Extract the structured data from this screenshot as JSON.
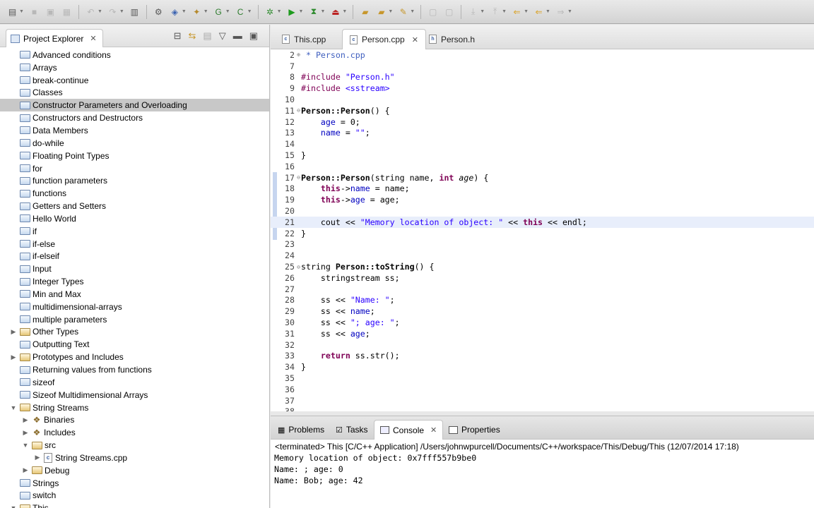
{
  "toolbar": {
    "icons": [
      "new-icon",
      "save-icon",
      "save-all-icon",
      "print-icon",
      "undo-icon",
      "build-icon",
      "gear-icon",
      "new-class-icon",
      "new-project-icon",
      "refresh-icon",
      "c-file-icon",
      "debug-icon",
      "run-icon",
      "external-tools-icon",
      "search-icon",
      "open-folder-icon",
      "edit-icon",
      "back-icon",
      "forward-icon"
    ]
  },
  "explorer": {
    "title": "Project Explorer",
    "items": [
      {
        "label": "Advanced conditions",
        "type": "folder",
        "indent": 0
      },
      {
        "label": "Arrays",
        "type": "folder",
        "indent": 0
      },
      {
        "label": "break-continue",
        "type": "folder",
        "indent": 0
      },
      {
        "label": "Classes",
        "type": "folder",
        "indent": 0
      },
      {
        "label": "Constructor Parameters and Overloading",
        "type": "folder",
        "indent": 0,
        "selected": true
      },
      {
        "label": "Constructors and Destructors",
        "type": "folder",
        "indent": 0
      },
      {
        "label": "Data Members",
        "type": "folder",
        "indent": 0
      },
      {
        "label": "do-while",
        "type": "folder",
        "indent": 0
      },
      {
        "label": "Floating Point Types",
        "type": "folder",
        "indent": 0
      },
      {
        "label": "for",
        "type": "folder",
        "indent": 0
      },
      {
        "label": "function parameters",
        "type": "folder",
        "indent": 0
      },
      {
        "label": "functions",
        "type": "folder",
        "indent": 0
      },
      {
        "label": "Getters and Setters",
        "type": "folder",
        "indent": 0
      },
      {
        "label": "Hello World",
        "type": "folder",
        "indent": 0
      },
      {
        "label": "if",
        "type": "folder",
        "indent": 0
      },
      {
        "label": "if-else",
        "type": "folder",
        "indent": 0
      },
      {
        "label": "if-elseif",
        "type": "folder",
        "indent": 0
      },
      {
        "label": "Input",
        "type": "folder",
        "indent": 0
      },
      {
        "label": "Integer Types",
        "type": "folder",
        "indent": 0
      },
      {
        "label": "Min and Max",
        "type": "folder",
        "indent": 0
      },
      {
        "label": "multidimensional-arrays",
        "type": "folder",
        "indent": 0
      },
      {
        "label": "multiple parameters",
        "type": "folder",
        "indent": 0
      },
      {
        "label": "Other Types",
        "type": "open",
        "indent": 0,
        "twisty": "▶"
      },
      {
        "label": "Outputting Text",
        "type": "folder",
        "indent": 0
      },
      {
        "label": "Prototypes and Includes",
        "type": "open",
        "indent": 0,
        "twisty": "▶"
      },
      {
        "label": "Returning values from functions",
        "type": "folder",
        "indent": 0
      },
      {
        "label": "sizeof",
        "type": "folder",
        "indent": 0
      },
      {
        "label": "Sizeof Multidimensional Arrays",
        "type": "folder",
        "indent": 0
      },
      {
        "label": "String Streams",
        "type": "open",
        "indent": 0,
        "twisty": "▼"
      },
      {
        "label": "Binaries",
        "type": "cfg",
        "indent": 1,
        "twisty": "▶"
      },
      {
        "label": "Includes",
        "type": "cfg",
        "indent": 1,
        "twisty": "▶"
      },
      {
        "label": "src",
        "type": "open",
        "indent": 1,
        "twisty": "▼"
      },
      {
        "label": "String Streams.cpp",
        "type": "file",
        "indent": 2,
        "twisty": "▶"
      },
      {
        "label": "Debug",
        "type": "open",
        "indent": 1,
        "twisty": "▶"
      },
      {
        "label": "Strings",
        "type": "folder",
        "indent": 0
      },
      {
        "label": "switch",
        "type": "folder",
        "indent": 0
      },
      {
        "label": "This",
        "type": "open",
        "indent": 0,
        "twisty": "▼"
      }
    ]
  },
  "editor": {
    "tabs": [
      {
        "label": "This.cpp",
        "active": false
      },
      {
        "label": "Person.cpp",
        "active": true
      },
      {
        "label": "Person.h",
        "active": false
      }
    ],
    "lines": [
      {
        "n": "2",
        "fold": "⊕",
        "html": "<span class=\"cm\"> * Person.cpp</span>"
      },
      {
        "n": "7",
        "fold": "",
        "html": ""
      },
      {
        "n": "8",
        "fold": "",
        "html": "<span class=\"p\">#include</span> <span class=\"s\">\"Person.h\"</span>"
      },
      {
        "n": "9",
        "fold": "",
        "html": "<span class=\"p\">#include</span> <span class=\"s\">&lt;sstream&gt;</span>"
      },
      {
        "n": "10",
        "fold": "",
        "html": ""
      },
      {
        "n": "11",
        "fold": "⊖",
        "html": "<b>Person::Person</b>() {"
      },
      {
        "n": "12",
        "fold": "",
        "html": "    <span class=\"m\">age</span> = 0;"
      },
      {
        "n": "13",
        "fold": "",
        "html": "    <span class=\"m\">name</span> = <span class=\"s\">\"\"</span>;"
      },
      {
        "n": "14",
        "fold": "",
        "html": ""
      },
      {
        "n": "15",
        "fold": "",
        "html": "}"
      },
      {
        "n": "16",
        "fold": "",
        "html": ""
      },
      {
        "n": "17",
        "fold": "⊖",
        "html": "<b>Person::Person</b>(string name, <span class=\"k\">int</span> <span class=\"it\">age</span>) {"
      },
      {
        "n": "18",
        "fold": "",
        "html": "    <span class=\"k\">this</span>-&gt;<span class=\"m\">name</span> = name;"
      },
      {
        "n": "19",
        "fold": "",
        "html": "    <span class=\"k\">this</span>-&gt;<span class=\"m\">age</span> = age;"
      },
      {
        "n": "20",
        "fold": "",
        "html": ""
      },
      {
        "n": "21",
        "fold": "",
        "html": "    cout &lt;&lt; <span class=\"s\">\"Memory location of object: \"</span> &lt;&lt; <span class=\"k\">this</span> &lt;&lt; endl;"
      },
      {
        "n": "22",
        "fold": "",
        "html": "}"
      },
      {
        "n": "23",
        "fold": "",
        "html": ""
      },
      {
        "n": "24",
        "fold": "",
        "html": ""
      },
      {
        "n": "25",
        "fold": "⊖",
        "html": "string <b>Person::toString</b>() {"
      },
      {
        "n": "26",
        "fold": "",
        "html": "    stringstream ss;"
      },
      {
        "n": "27",
        "fold": "",
        "html": ""
      },
      {
        "n": "28",
        "fold": "",
        "html": "    ss &lt;&lt; <span class=\"s\">\"Name: \"</span>;"
      },
      {
        "n": "29",
        "fold": "",
        "html": "    ss &lt;&lt; <span class=\"m\">name</span>;"
      },
      {
        "n": "30",
        "fold": "",
        "html": "    ss &lt;&lt; <span class=\"s\">\"; age: \"</span>;"
      },
      {
        "n": "31",
        "fold": "",
        "html": "    ss &lt;&lt; <span class=\"m\">age</span>;"
      },
      {
        "n": "32",
        "fold": "",
        "html": ""
      },
      {
        "n": "33",
        "fold": "",
        "html": "    <span class=\"k\">return</span> ss.str();"
      },
      {
        "n": "34",
        "fold": "",
        "html": "}"
      },
      {
        "n": "35",
        "fold": "",
        "html": ""
      },
      {
        "n": "36",
        "fold": "",
        "html": ""
      },
      {
        "n": "37",
        "fold": "",
        "html": ""
      },
      {
        "n": "38",
        "fold": "",
        "html": ""
      }
    ]
  },
  "console": {
    "tabs": [
      {
        "label": "Problems",
        "active": false,
        "icon": "problems-icon"
      },
      {
        "label": "Tasks",
        "active": false,
        "icon": "tasks-icon"
      },
      {
        "label": "Console",
        "active": true,
        "icon": "console-icon"
      },
      {
        "label": "Properties",
        "active": false,
        "icon": "properties-icon"
      }
    ],
    "status": "<terminated> This [C/C++ Application] /Users/johnwpurcell/Documents/C++/workspace/This/Debug/This (12/07/2014 17:18)",
    "output": [
      "Memory location of object: 0x7fff557b9be0",
      "Name: ; age: 0",
      "Name: Bob; age: 42"
    ]
  }
}
